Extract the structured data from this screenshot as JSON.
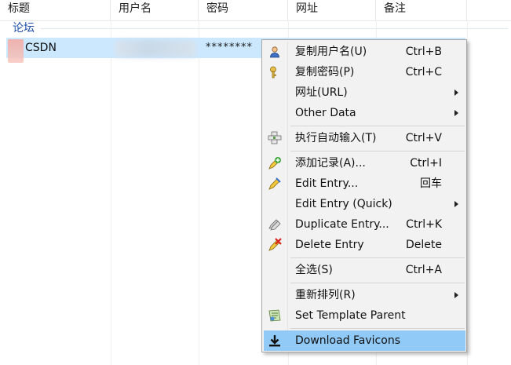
{
  "columns": [
    "标题",
    "用户名",
    "密码",
    "网址",
    "备注"
  ],
  "group_label": "论坛",
  "entry": {
    "title": "CSDN",
    "password": "********"
  },
  "menu": {
    "items": [
      {
        "label": "复制用户名(U)",
        "shortcut": "Ctrl+B",
        "icon": "user-icon"
      },
      {
        "label": "复制密码(P)",
        "shortcut": "Ctrl+C",
        "icon": "key-icon"
      },
      {
        "label": "网址(URL)",
        "shortcut": "",
        "submenu": true
      },
      {
        "label": "Other Data",
        "shortcut": "",
        "submenu": true
      },
      {
        "label": "执行自动输入(T)",
        "shortcut": "Ctrl+V",
        "icon": "autotype-icon"
      },
      {
        "label": "添加记录(A)...",
        "shortcut": "Ctrl+I",
        "icon": "add-entry-icon"
      },
      {
        "label": "Edit Entry...",
        "shortcut": "回车",
        "icon": "edit-entry-icon"
      },
      {
        "label": "Edit Entry (Quick)",
        "shortcut": "",
        "submenu": true
      },
      {
        "label": "Duplicate Entry...",
        "shortcut": "Ctrl+K",
        "icon": "duplicate-icon"
      },
      {
        "label": "Delete Entry",
        "shortcut": "Delete",
        "icon": "delete-icon"
      },
      {
        "label": "全选(S)",
        "shortcut": "Ctrl+A"
      },
      {
        "label": "重新排列(R)",
        "shortcut": "",
        "submenu": true
      },
      {
        "label": "Set Template Parent",
        "shortcut": "",
        "icon": "template-icon"
      },
      {
        "label": "Download Favicons",
        "shortcut": "",
        "icon": "download-icon",
        "highlighted": true
      }
    ]
  }
}
